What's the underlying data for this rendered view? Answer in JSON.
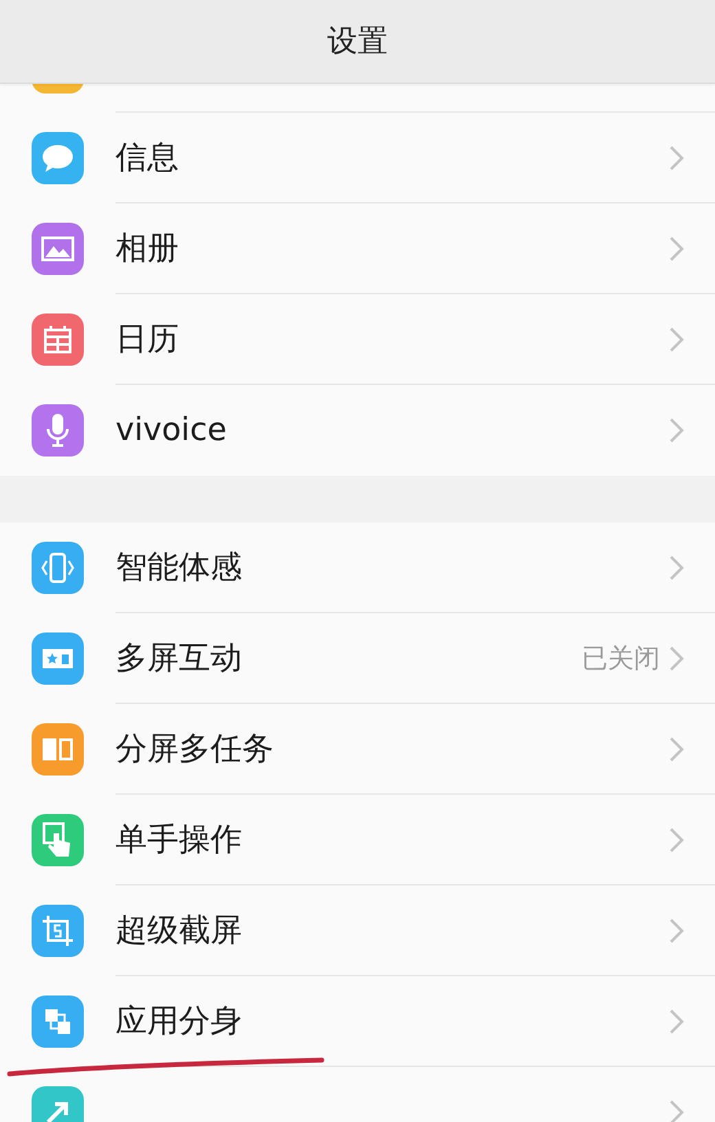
{
  "header": {
    "title": "设置"
  },
  "sections": [
    {
      "items": [
        {
          "kind": "contacts",
          "underlined": false
        },
        {
          "label": "信息",
          "kind": "message",
          "underlined": false
        },
        {
          "label": "相册",
          "kind": "photo",
          "underlined": false
        },
        {
          "label": "日历",
          "kind": "calendar",
          "underlined": false
        },
        {
          "label": "vivoice",
          "kind": "mic",
          "underlined": false
        }
      ]
    },
    {
      "items": [
        {
          "label": "智能体感",
          "kind": "motion",
          "underlined": false
        },
        {
          "label": "多屏互动",
          "kind": "cast",
          "value": "已关闭",
          "underlined": false
        },
        {
          "label": "分屏多任务",
          "kind": "split",
          "underlined": false
        },
        {
          "label": "单手操作",
          "kind": "hand",
          "underlined": false
        },
        {
          "label": "超级截屏",
          "kind": "screenshot",
          "underlined": false
        },
        {
          "label": "应用分身",
          "kind": "clone",
          "underlined": true
        },
        {
          "kind": "shortcut",
          "underlined": false
        }
      ]
    }
  ]
}
